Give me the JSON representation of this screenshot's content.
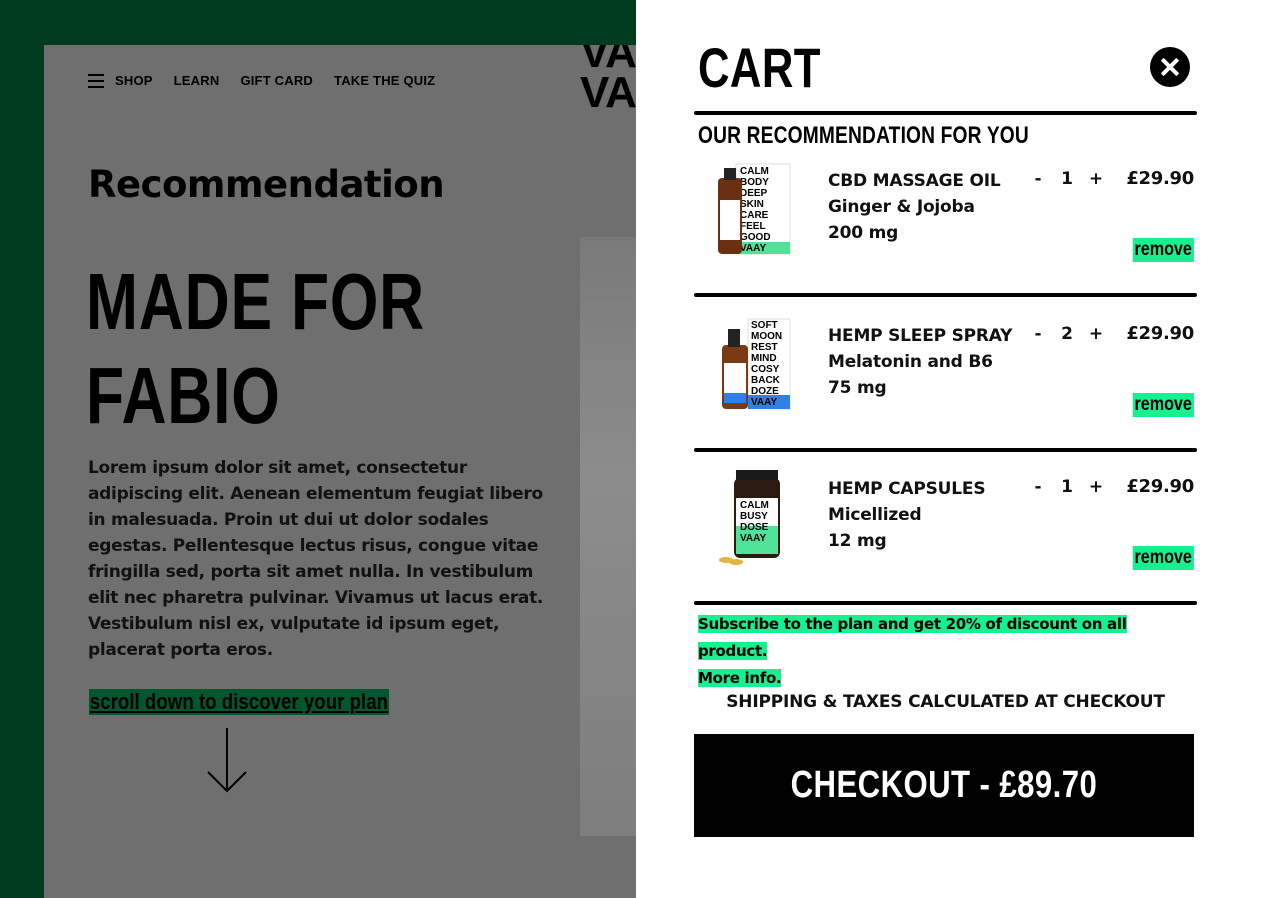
{
  "colors": {
    "frame_green": "#003b1f",
    "overlay_gray": "#6f6f6f",
    "accent_green": "#17f08f",
    "scroll_highlight": "#00572e",
    "black": "#000000",
    "white": "#ffffff"
  },
  "nav": {
    "menu_icon": "hamburger-icon",
    "items": [
      "SHOP",
      "LEARN",
      "GIFT CARD",
      "TAKE THE QUIZ"
    ]
  },
  "logo": {
    "line1": "VA",
    "line2": "VA"
  },
  "main": {
    "section_title": "Recommendation",
    "headline_line1": "MADE FOR",
    "headline_line2": "FABIO",
    "body": "Lorem ipsum dolor sit amet, consectetur adipiscing elit. Aenean elementum feugiat libero in malesuada. Proin ut dui ut dolor sodales egestas. Pellentesque lectus risus, congue vitae fringilla sed, porta sit amet nulla. In vestibulum elit nec pharetra pulvinar. Vivamus ut lacus erat. Vestibulum nisl ex, vulputate id ipsum eget, placerat porta eros.",
    "scroll_link": "scroll down to discover your plan",
    "arrow_icon": "arrow-down-icon"
  },
  "cart": {
    "title": "CART",
    "close_icon": "close-icon",
    "recommendation_label": "OUR RECOMMENDATION FOR YOU",
    "items": [
      {
        "name": "CBD MASSAGE OIL",
        "variant": "Ginger & Jojoba",
        "strength": "200 mg",
        "qty": "1",
        "price": "£29.90",
        "minus": "-",
        "plus": "+",
        "remove": "remove",
        "box_color": "#4fe39a",
        "box_words": [
          "CALM",
          "BODY",
          "DEEP",
          "SKIN",
          "CARE",
          "FEEL",
          "GOOD",
          "VAAY"
        ]
      },
      {
        "name": "HEMP SLEEP SPRAY",
        "variant": "Melatonin and B6",
        "strength": "75 mg",
        "qty": "2",
        "price": "£29.90",
        "minus": "-",
        "plus": "+",
        "remove": "remove",
        "box_color": "#2f7fe6",
        "box_words": [
          "SOFT",
          "MOON",
          "REST",
          "MIND",
          "COSY",
          "BACK",
          "DOZE",
          "VAAY"
        ]
      },
      {
        "name": "HEMP CAPSULES",
        "variant": "Micellized",
        "strength": "12 mg",
        "qty": "1",
        "price": "£29.90",
        "minus": "-",
        "plus": "+",
        "remove": "remove",
        "box_color": "#4fe39a",
        "box_words": [
          "CALM",
          "BUSY",
          "DOSE",
          "VAAY"
        ]
      }
    ],
    "promo_line1": "Subscribe to the plan and get 20% of discount on all product.",
    "promo_line2": "More info.",
    "shipping_note": "SHIPPING & TAXES CALCULATED AT CHECKOUT",
    "checkout_label": "CHECKOUT - £89.70"
  }
}
